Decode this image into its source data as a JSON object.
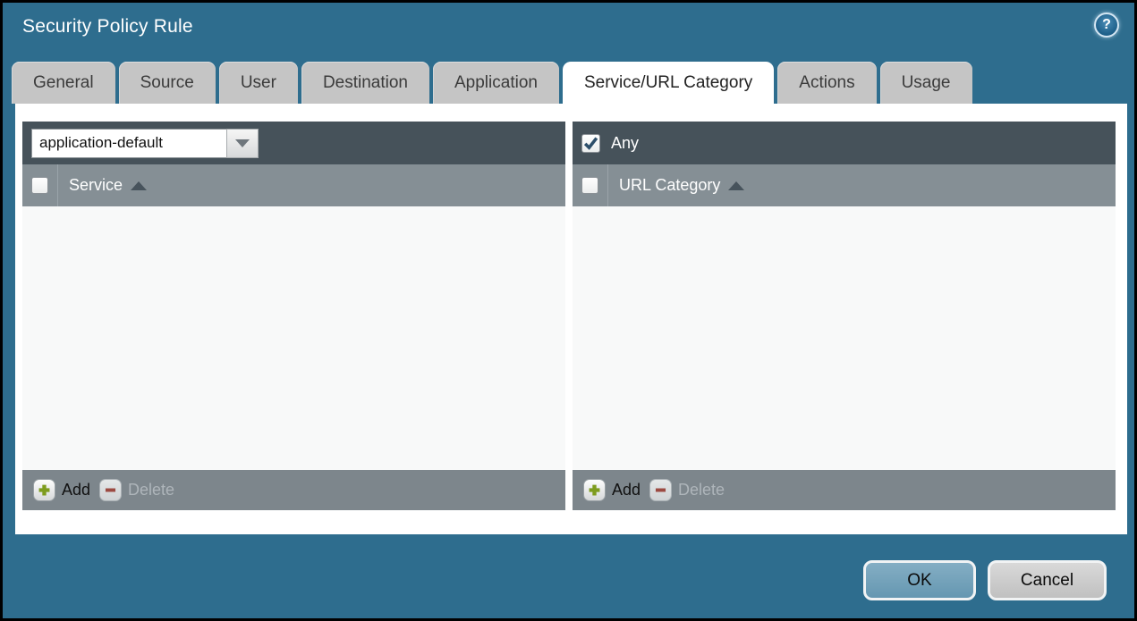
{
  "window": {
    "title": "Security Policy Rule"
  },
  "icons": {
    "help_glyph": "?"
  },
  "tabs": [
    {
      "label": "General",
      "active": false
    },
    {
      "label": "Source",
      "active": false
    },
    {
      "label": "User",
      "active": false
    },
    {
      "label": "Destination",
      "active": false
    },
    {
      "label": "Application",
      "active": false
    },
    {
      "label": "Service/URL Category",
      "active": true
    },
    {
      "label": "Actions",
      "active": false
    },
    {
      "label": "Usage",
      "active": false
    }
  ],
  "service_panel": {
    "dropdown_value": "application-default",
    "column_header": "Service",
    "sort_direction": "ascending",
    "header_checkbox_checked": false,
    "rows": [],
    "add_label": "Add",
    "delete_label": "Delete",
    "delete_enabled": false
  },
  "url_category_panel": {
    "any_label": "Any",
    "any_checked": true,
    "column_header": "URL Category",
    "sort_direction": "ascending",
    "header_checkbox_checked": false,
    "rows": [],
    "add_label": "Add",
    "delete_label": "Delete",
    "delete_enabled": false
  },
  "dialog_buttons": {
    "ok_label": "OK",
    "cancel_label": "Cancel"
  },
  "colors": {
    "dialog_background": "#2e6d8e",
    "panel_header": "#46525a",
    "panel_subheader": "#858f95",
    "panel_footer": "#7d868c",
    "panel_body": "#f8f9f9",
    "tab_inactive": "#c5c5c5",
    "tab_active": "#ffffff",
    "ok_button_fill": "#74a3bb",
    "cancel_button_fill": "#cccccc",
    "add_icon_green": "#7e9c1e",
    "delete_icon_red": "#9c4a42",
    "checkbox_check": "#2d4f6b"
  }
}
